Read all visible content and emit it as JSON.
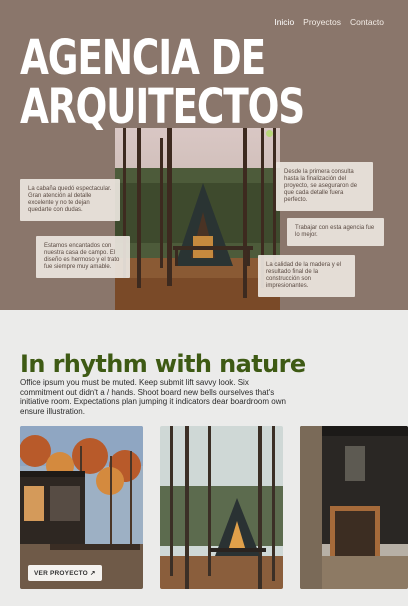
{
  "nav": {
    "items": [
      "Inicio",
      "Proyectos",
      "Contacto"
    ]
  },
  "hero": {
    "title_line1": "AGENCIA DE",
    "title_line2": "ARQUITECTOS",
    "testimonials": [
      "La cabaña quedó espectacular. Gran atención al detalle excelente y no te dejan quedarte con dudas.",
      "Estamos encantados con nuestra casa de campo. El diseño es hermoso y el trato fue siempre muy amable.",
      "Desde la primera consulta hasta la finalización del proyecto, se aseguraron de que cada detalle fuera perfecto.",
      "Trabajar con esta agencia fue lo mejor.",
      "La calidad de la madera y el resultado final de la construcción son impresionantes."
    ]
  },
  "section": {
    "heading": "In rhythm with nature",
    "body": "Office ipsum you must be muted. Keep submit lift savvy look. Six commitment out didn't a / hands. Shoot board new bells ourselves that's initiative room. Expectations plan jumping it indicators dear boardroom own ensure illustration.",
    "cta_label": "VER PROYECTO",
    "cta_icon": "arrow-up-right-icon"
  },
  "colors": {
    "hero_bg": "#8a766b",
    "accent_green": "#3e5a14",
    "page_bg": "#ebebea"
  }
}
